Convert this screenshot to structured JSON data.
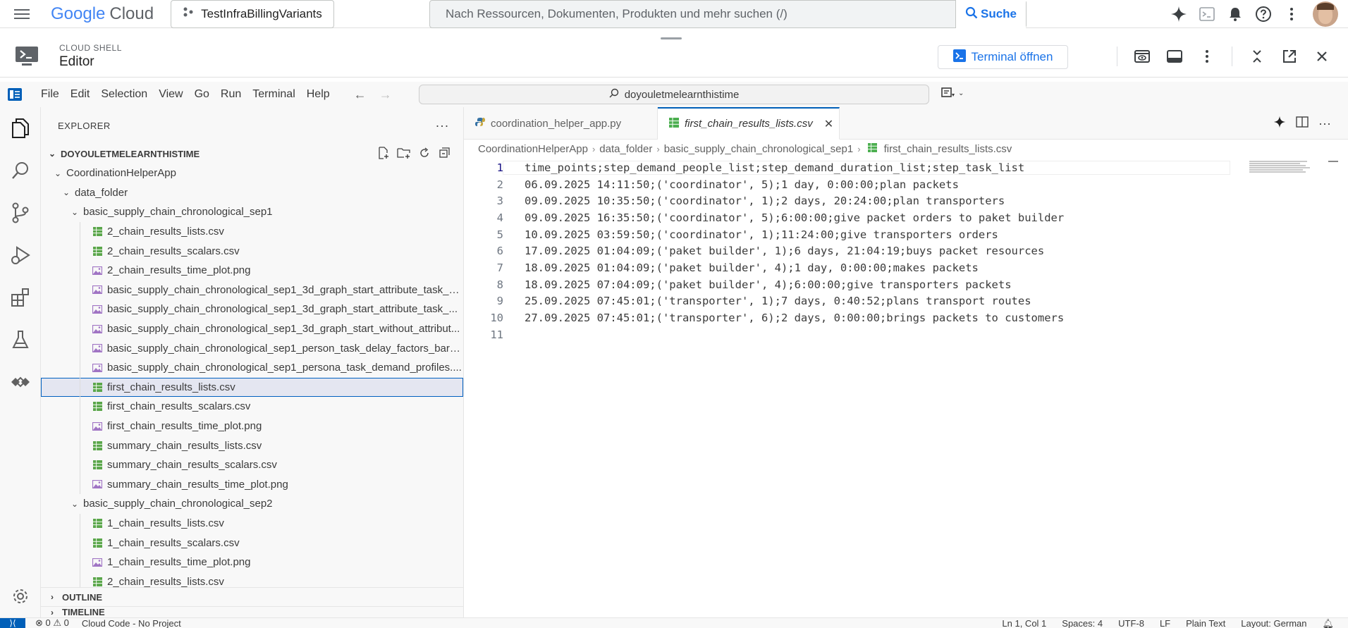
{
  "topbar": {
    "logo_google": "Google",
    "logo_cloud": "Cloud",
    "project_name": "TestInfraBillingVariants",
    "search_placeholder": "Nach Ressourcen, Dokumenten, Produkten und mehr suchen (/)",
    "search_button": "Suche"
  },
  "shell": {
    "supertitle": "CLOUD SHELL",
    "title": "Editor",
    "terminal_button": "Terminal öffnen"
  },
  "menubar": {
    "items": [
      "File",
      "Edit",
      "Selection",
      "View",
      "Go",
      "Run",
      "Terminal",
      "Help"
    ],
    "command_center": "doyouletmelearnthistime"
  },
  "explorer": {
    "header": "EXPLORER",
    "root": "DOYOULETMELEARNTHISTIME",
    "tree": [
      {
        "label": "CoordinationHelperApp",
        "type": "folder",
        "depth": 0,
        "open": true
      },
      {
        "label": "data_folder",
        "type": "folder",
        "depth": 1,
        "open": true
      },
      {
        "label": "basic_supply_chain_chronological_sep1",
        "type": "folder",
        "depth": 2,
        "open": true
      },
      {
        "label": "2_chain_results_lists.csv",
        "type": "csv",
        "depth": 3
      },
      {
        "label": "2_chain_results_scalars.csv",
        "type": "csv",
        "depth": 3
      },
      {
        "label": "2_chain_results_time_plot.png",
        "type": "png",
        "depth": 3
      },
      {
        "label": "basic_supply_chain_chronological_sep1_3d_graph_start_attribute_task_b...",
        "type": "png",
        "depth": 3
      },
      {
        "label": "basic_supply_chain_chronological_sep1_3d_graph_start_attribute_task_...",
        "type": "png",
        "depth": 3
      },
      {
        "label": "basic_supply_chain_chronological_sep1_3d_graph_start_without_attribut...",
        "type": "png",
        "depth": 3
      },
      {
        "label": "basic_supply_chain_chronological_sep1_person_task_delay_factors_barp...",
        "type": "png",
        "depth": 3
      },
      {
        "label": "basic_supply_chain_chronological_sep1_persona_task_demand_profiles....",
        "type": "png",
        "depth": 3
      },
      {
        "label": "first_chain_results_lists.csv",
        "type": "csv",
        "depth": 3,
        "selected": true
      },
      {
        "label": "first_chain_results_scalars.csv",
        "type": "csv",
        "depth": 3
      },
      {
        "label": "first_chain_results_time_plot.png",
        "type": "png",
        "depth": 3
      },
      {
        "label": "summary_chain_results_lists.csv",
        "type": "csv",
        "depth": 3
      },
      {
        "label": "summary_chain_results_scalars.csv",
        "type": "csv",
        "depth": 3
      },
      {
        "label": "summary_chain_results_time_plot.png",
        "type": "png",
        "depth": 3
      },
      {
        "label": "basic_supply_chain_chronological_sep2",
        "type": "folder",
        "depth": 2,
        "open": true
      },
      {
        "label": "1_chain_results_lists.csv",
        "type": "csv",
        "depth": 3
      },
      {
        "label": "1_chain_results_scalars.csv",
        "type": "csv",
        "depth": 3
      },
      {
        "label": "1_chain_results_time_plot.png",
        "type": "png",
        "depth": 3
      },
      {
        "label": "2_chain_results_lists.csv",
        "type": "csv",
        "depth": 3
      }
    ],
    "outline": "OUTLINE",
    "timeline": "TIMELINE"
  },
  "editor": {
    "tabs": [
      {
        "label": "coordination_helper_app.py",
        "active": false
      },
      {
        "label": "first_chain_results_lists.csv",
        "active": true
      }
    ],
    "breadcrumbs": [
      "CoordinationHelperApp",
      "data_folder",
      "basic_supply_chain_chronological_sep1",
      "first_chain_results_lists.csv"
    ],
    "lines": [
      "time_points;step_demand_people_list;step_demand_duration_list;step_task_list",
      "06.09.2025 14:11:50;('coordinator', 5);1 day, 0:00:00;plan packets",
      "09.09.2025 10:35:50;('coordinator', 1);2 days, 20:24:00;plan transporters",
      "09.09.2025 16:35:50;('coordinator', 5);6:00:00;give packet orders to paket builder",
      "10.09.2025 03:59:50;('coordinator', 1);11:24:00;give transporters orders",
      "17.09.2025 01:04:09;('paket builder', 1);6 days, 21:04:19;buys packet resources",
      "18.09.2025 01:04:09;('paket builder', 4);1 day, 0:00:00;makes packets",
      "18.09.2025 07:04:09;('paket builder', 4);6:00:00;give transporters packets",
      "25.09.2025 07:45:01;('transporter', 1);7 days, 0:40:52;plans transport routes",
      "27.09.2025 07:45:01;('transporter', 6);2 days, 0:00:00;brings packets to customers",
      ""
    ]
  },
  "statusbar": {
    "problems": "⊗ 0 ⚠ 0",
    "cloud_code": "Cloud Code - No Project",
    "position": "Ln 1, Col 1",
    "spaces": "Spaces: 4",
    "encoding": "UTF-8",
    "eol": "LF",
    "language": "Plain Text",
    "layout": "Layout: German"
  }
}
